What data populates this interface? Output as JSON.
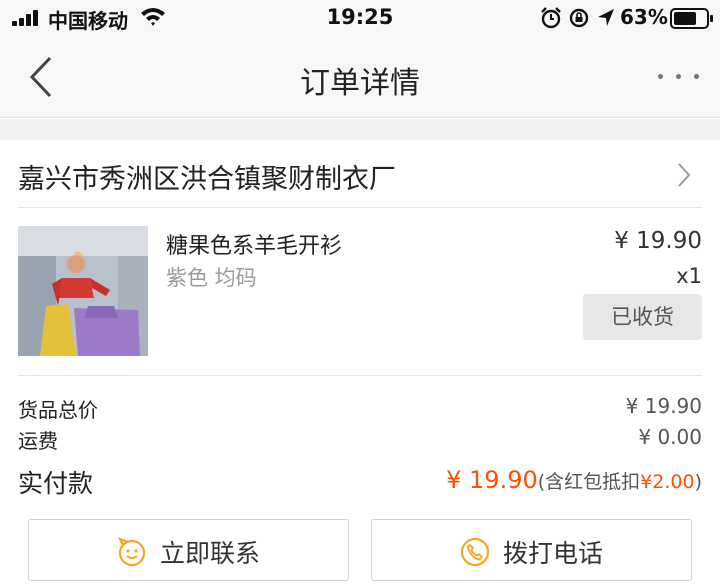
{
  "status_bar": {
    "carrier": "中国移动",
    "time": "19:25",
    "battery": "63%"
  },
  "nav": {
    "title": "订单详情",
    "back_icon": "chevron-left-icon",
    "more_icon": "more-dots-icon"
  },
  "shop": {
    "name": "嘉兴市秀洲区洪合镇聚财制衣厂"
  },
  "product": {
    "title": "糖果色系羊毛开衫",
    "spec": "紫色 均码",
    "price": "¥ 19.90",
    "quantity": "x1",
    "status_label": "已收货"
  },
  "summary": {
    "goods_label": "货品总价",
    "goods_value": "¥ 19.90",
    "shipping_label": "运费",
    "shipping_value": "¥ 0.00",
    "paid_label": "实付款",
    "paid_amount": "¥ 19.90",
    "paid_note_prefix": "(含红包抵扣",
    "paid_discount": "¥2.00",
    "paid_note_suffix": ")"
  },
  "actions": {
    "contact_label": "立即联系",
    "call_label": "拨打电话"
  },
  "colors": {
    "accent": "#ff5000",
    "icon_orange": "#f5a623"
  }
}
